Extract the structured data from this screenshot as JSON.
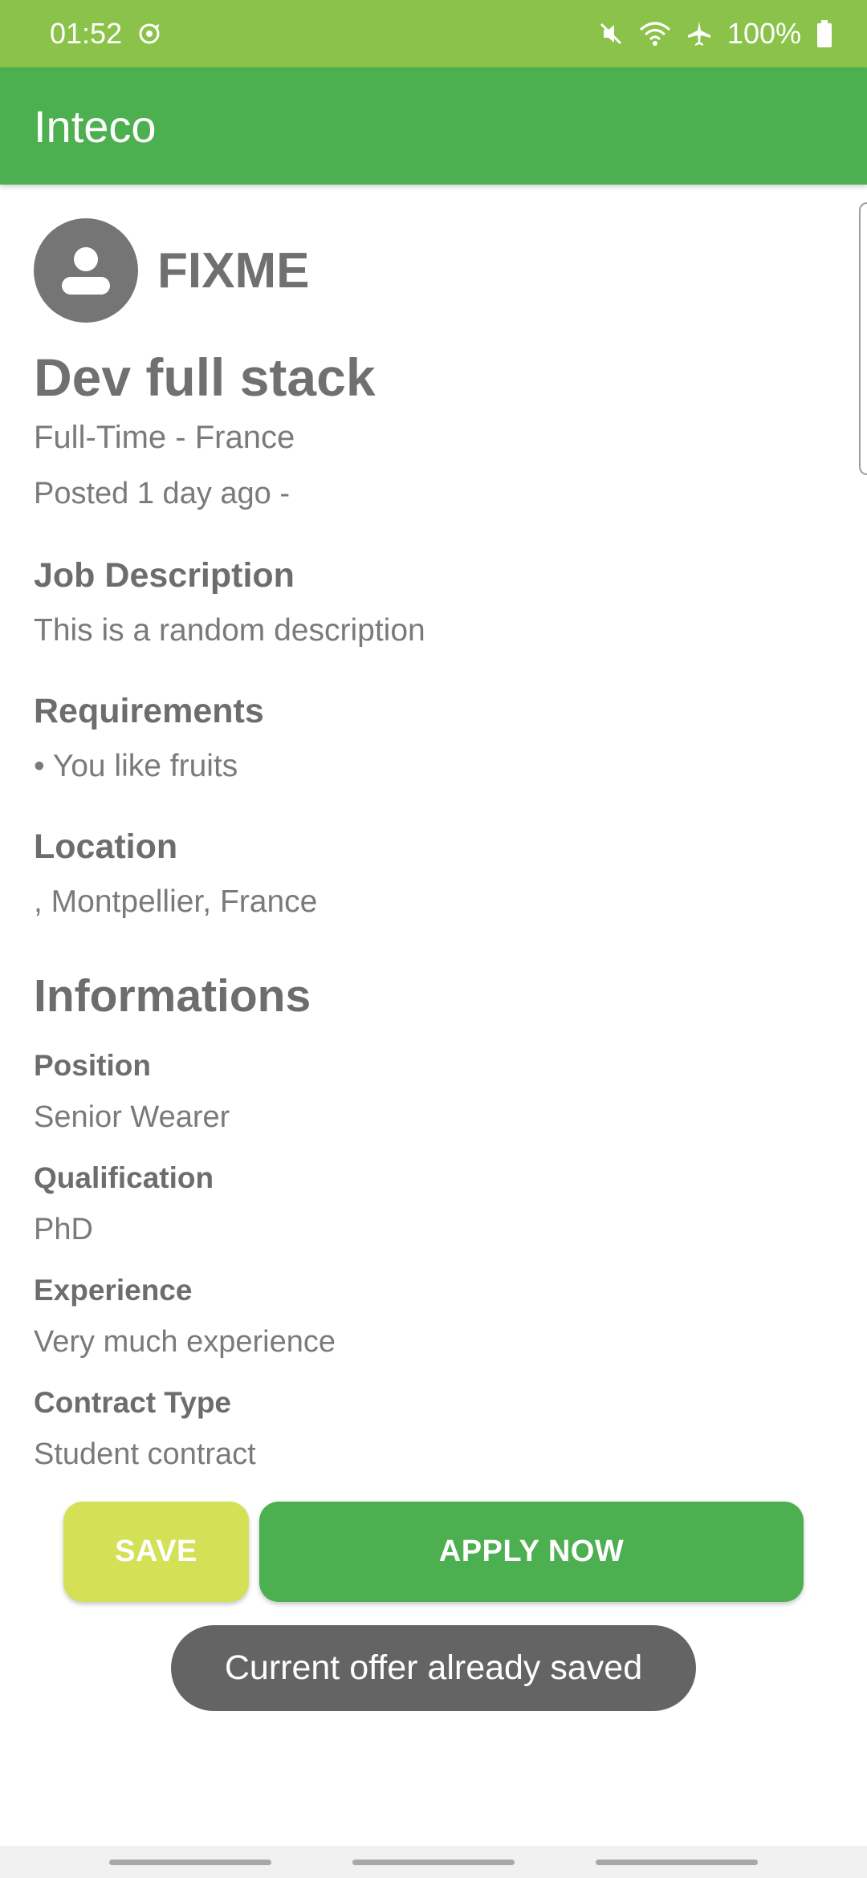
{
  "status_bar": {
    "time": "01:52",
    "battery": "100%",
    "icons": [
      "sync-icon",
      "mute-icon",
      "wifi-icon",
      "airplane-icon",
      "battery-icon"
    ]
  },
  "app_bar": {
    "title": "Inteco"
  },
  "job": {
    "company": "FIXME",
    "title": "Dev full stack",
    "type_country": "Full-Time  - France",
    "posted": "Posted 1 day ago -"
  },
  "sections": {
    "description_title": "Job Description",
    "description_text": "This is a random description",
    "requirements_title": "Requirements",
    "requirements_item": "• You like fruits",
    "location_title": "Location",
    "location_text": ", Montpellier, France"
  },
  "informations": {
    "heading": "Informations",
    "position_label": "Position",
    "position_value": "Senior Wearer",
    "qualification_label": "Qualification",
    "qualification_value": "PhD",
    "experience_label": "Experience",
    "experience_value": "Very much experience",
    "contract_label": "Contract Type",
    "contract_value": "Student contract"
  },
  "actions": {
    "save_label": "SAVE",
    "apply_label": "APPLY NOW"
  },
  "toast": {
    "message": "Current offer already saved"
  },
  "colors": {
    "status_bar": "#8bc34a",
    "app_bar": "#4caf50",
    "save_button": "#d4e157",
    "apply_button": "#4caf50",
    "toast": "#646464"
  }
}
